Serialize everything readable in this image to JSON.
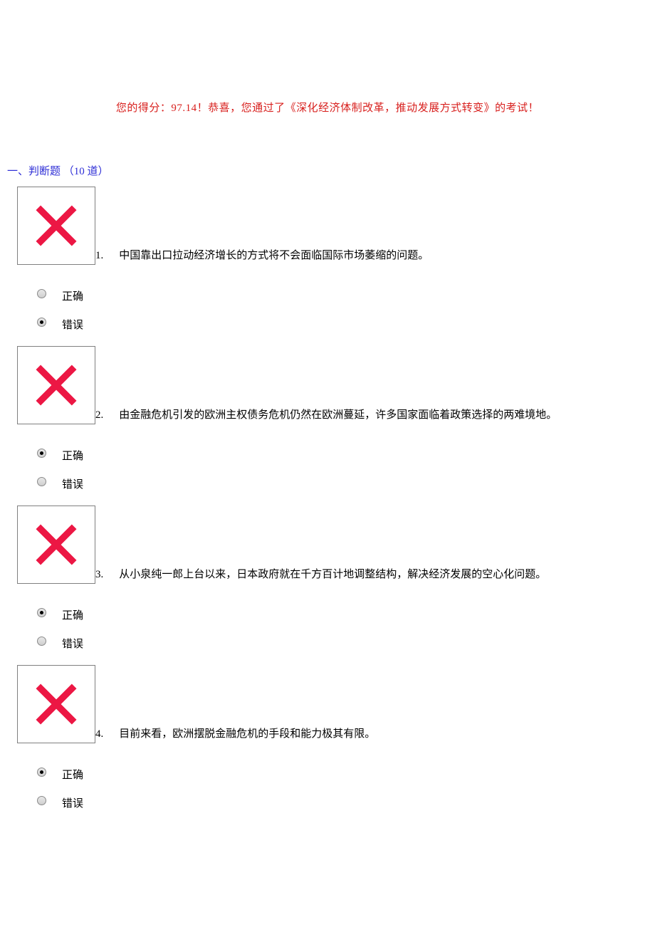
{
  "score_line": "您的得分：97.14！恭喜，您通过了《深化经济体制改革，推动发展方式转变》的考试！",
  "section_header": "一、判断题 （10 道）",
  "mark_color": "#ec1744",
  "option_labels": {
    "true": "正确",
    "false": "错误"
  },
  "questions": [
    {
      "number": "1.",
      "text": "中国靠出口拉动经济增长的方式将不会面临国际市场萎缩的问题。",
      "selected": "false"
    },
    {
      "number": "2.",
      "text": "由金融危机引发的欧洲主权债务危机仍然在欧洲蔓延，许多国家面临着政策选择的两难境地。",
      "selected": "true"
    },
    {
      "number": "3.",
      "text": "从小泉纯一郎上台以来，日本政府就在千方百计地调整结构，解决经济发展的空心化问题。",
      "selected": "true"
    },
    {
      "number": "4.",
      "text": "目前来看，欧洲摆脱金融危机的手段和能力极其有限。",
      "selected": "true"
    }
  ]
}
